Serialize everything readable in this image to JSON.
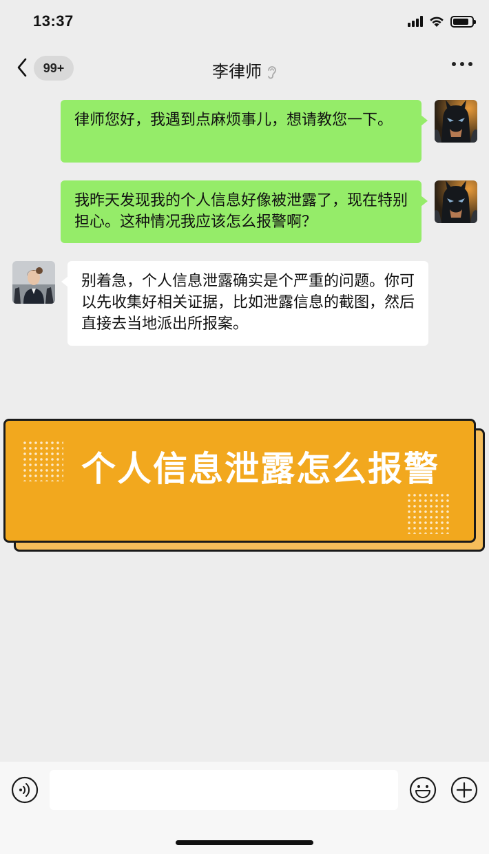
{
  "status_bar": {
    "time": "13:37"
  },
  "nav": {
    "unread_count": "99+",
    "title": "李律师"
  },
  "messages": [
    {
      "side": "right",
      "sender": "me",
      "text": "律师您好，我遇到点麻烦事儿，想请教您一下。"
    },
    {
      "side": "right",
      "sender": "me",
      "text": "我昨天发现我的个人信息好像被泄露了，现在特别担心。这种情况我应该怎么报警啊？"
    },
    {
      "side": "left",
      "sender": "李律师",
      "text": "别着急，个人信息泄露确实是个严重的问题。你可以先收集好相关证据，比如泄露信息的截图，然后直接去当地派出所报案。"
    }
  ],
  "banner": {
    "title": "个人信息泄露怎么报警",
    "color": "#f2a81e"
  },
  "input": {
    "value": "",
    "placeholder": ""
  },
  "colors": {
    "outgoing_bubble": "#95ec69",
    "incoming_bubble": "#ffffff",
    "background": "#ededed"
  }
}
